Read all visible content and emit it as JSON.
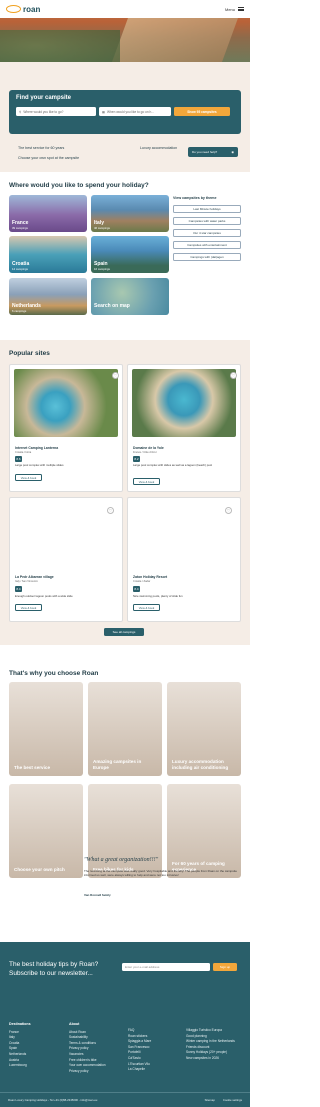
{
  "header": {
    "logo_text": "roan",
    "logo_sub": "Luxury Camping Holidays",
    "menu_label": "Menu"
  },
  "search": {
    "title": "Find your campsite",
    "field_where_placeholder": "Where would you like to go?",
    "field_when_placeholder": "When would you like to go on h...",
    "button_label": "Show 95 campsites"
  },
  "usps": [
    "The best service for 60 years",
    "Choose your own spot at the campsite",
    "Luxury accommodation"
  ],
  "chat": {
    "label": "Do you need help?"
  },
  "destinations": {
    "title": "Where would you like to spend your holiday?",
    "tiles": [
      {
        "name": "France",
        "count": "39 campings"
      },
      {
        "name": "Italy",
        "count": "46 campings"
      },
      {
        "name": "Croatia",
        "count": "14 campings"
      },
      {
        "name": "Spain",
        "count": "16 campings"
      },
      {
        "name": "Netherlands",
        "count": "6 campings"
      },
      {
        "name": "Search on map",
        "count": ""
      }
    ],
    "themes_title": "View campsites by theme",
    "themes": [
      "Last Minute holidays",
      "Campsites with water parks",
      "Our 4 star campsites",
      "Campsites with entertainment",
      "Campings with (dat)agen"
    ]
  },
  "popular": {
    "title": "Popular sites",
    "cards": [
      {
        "name": "Internet Camping Lanterna",
        "loc": "Croatia / Istria",
        "score": "8.6",
        "desc": "Large pool complex with multiple slides",
        "button": "View & book"
      },
      {
        "name": "Domaine de la Yole",
        "loc": "France / Côte d'Azur",
        "score": "8.2",
        "desc": "Large pool complex with slides as well as a lagoon (beach) pool",
        "button": "View & book"
      },
      {
        "name": "La Pedr Albarran village",
        "loc": "Italy / San Vincenzo",
        "score": "8.4",
        "desc": "Enough outdoor lagoon pools with a wide slide",
        "button": "View & book"
      },
      {
        "name": "Zaton Holiday Resort",
        "loc": "Croatia / Zadar",
        "score": "8.4",
        "desc": "Nice swimming pools, plenty of slide fun",
        "button": "View & book"
      }
    ],
    "all_button": "See all campings"
  },
  "why": {
    "title": "That's why you choose Roan",
    "items": [
      "The best service",
      "Amazing campsites in Europe",
      "Luxury accommodation including air conditioning",
      "Choose your own pitch",
      "Free bikes for kids",
      "For 60 years of camping experience"
    ]
  },
  "review": {
    "quote": "\"What a great organization!!!\"",
    "text": "The receiving at the campsite was really good. Very hospitable and friendly! The people from Roan on the campsite informed us well, were always willing to help and were not too intrusive!",
    "author": "Van Ronnell family"
  },
  "newsletter": {
    "title": "The best holiday tips by Roan? Subscribe to our newsletter...",
    "placeholder": "Enter your e-mail address",
    "button": "Sign up"
  },
  "footer_cols": [
    {
      "title": "Destinations",
      "items": [
        "France",
        "Italy",
        "Croatia",
        "Spain",
        "Netherlands",
        "Austria",
        "Luxembourg"
      ]
    },
    {
      "title": "About",
      "items": [
        "About Roan",
        "Sustainability",
        "Terms & conditions",
        "Privacy policy",
        "Vacancies",
        "Free children's bike",
        "Your own accommodation",
        "Privacy policy"
      ]
    },
    {
      "title": "",
      "items": [
        "FAQ",
        "Roan stickers",
        "Spiaggia a Mare",
        "San Francesco",
        "Portofelli",
        "Cá'Savio",
        "L'Escurtian Vilu",
        "La Chapelle"
      ]
    },
    {
      "title": "",
      "items": [
        "Villaggio Turistico Europa",
        "Good planning",
        "Winter camping in the Netherlands",
        "Friends discount",
        "Sunny Holidays (20+ people)",
        "New campsites in 2026"
      ]
    }
  ],
  "bottom": {
    "left": "Roan Luxury Camping Holidays - Tel +31 (0)88-2345000 - info@roan.eu",
    "links": [
      "Sitemap",
      "Cookie settings"
    ]
  }
}
